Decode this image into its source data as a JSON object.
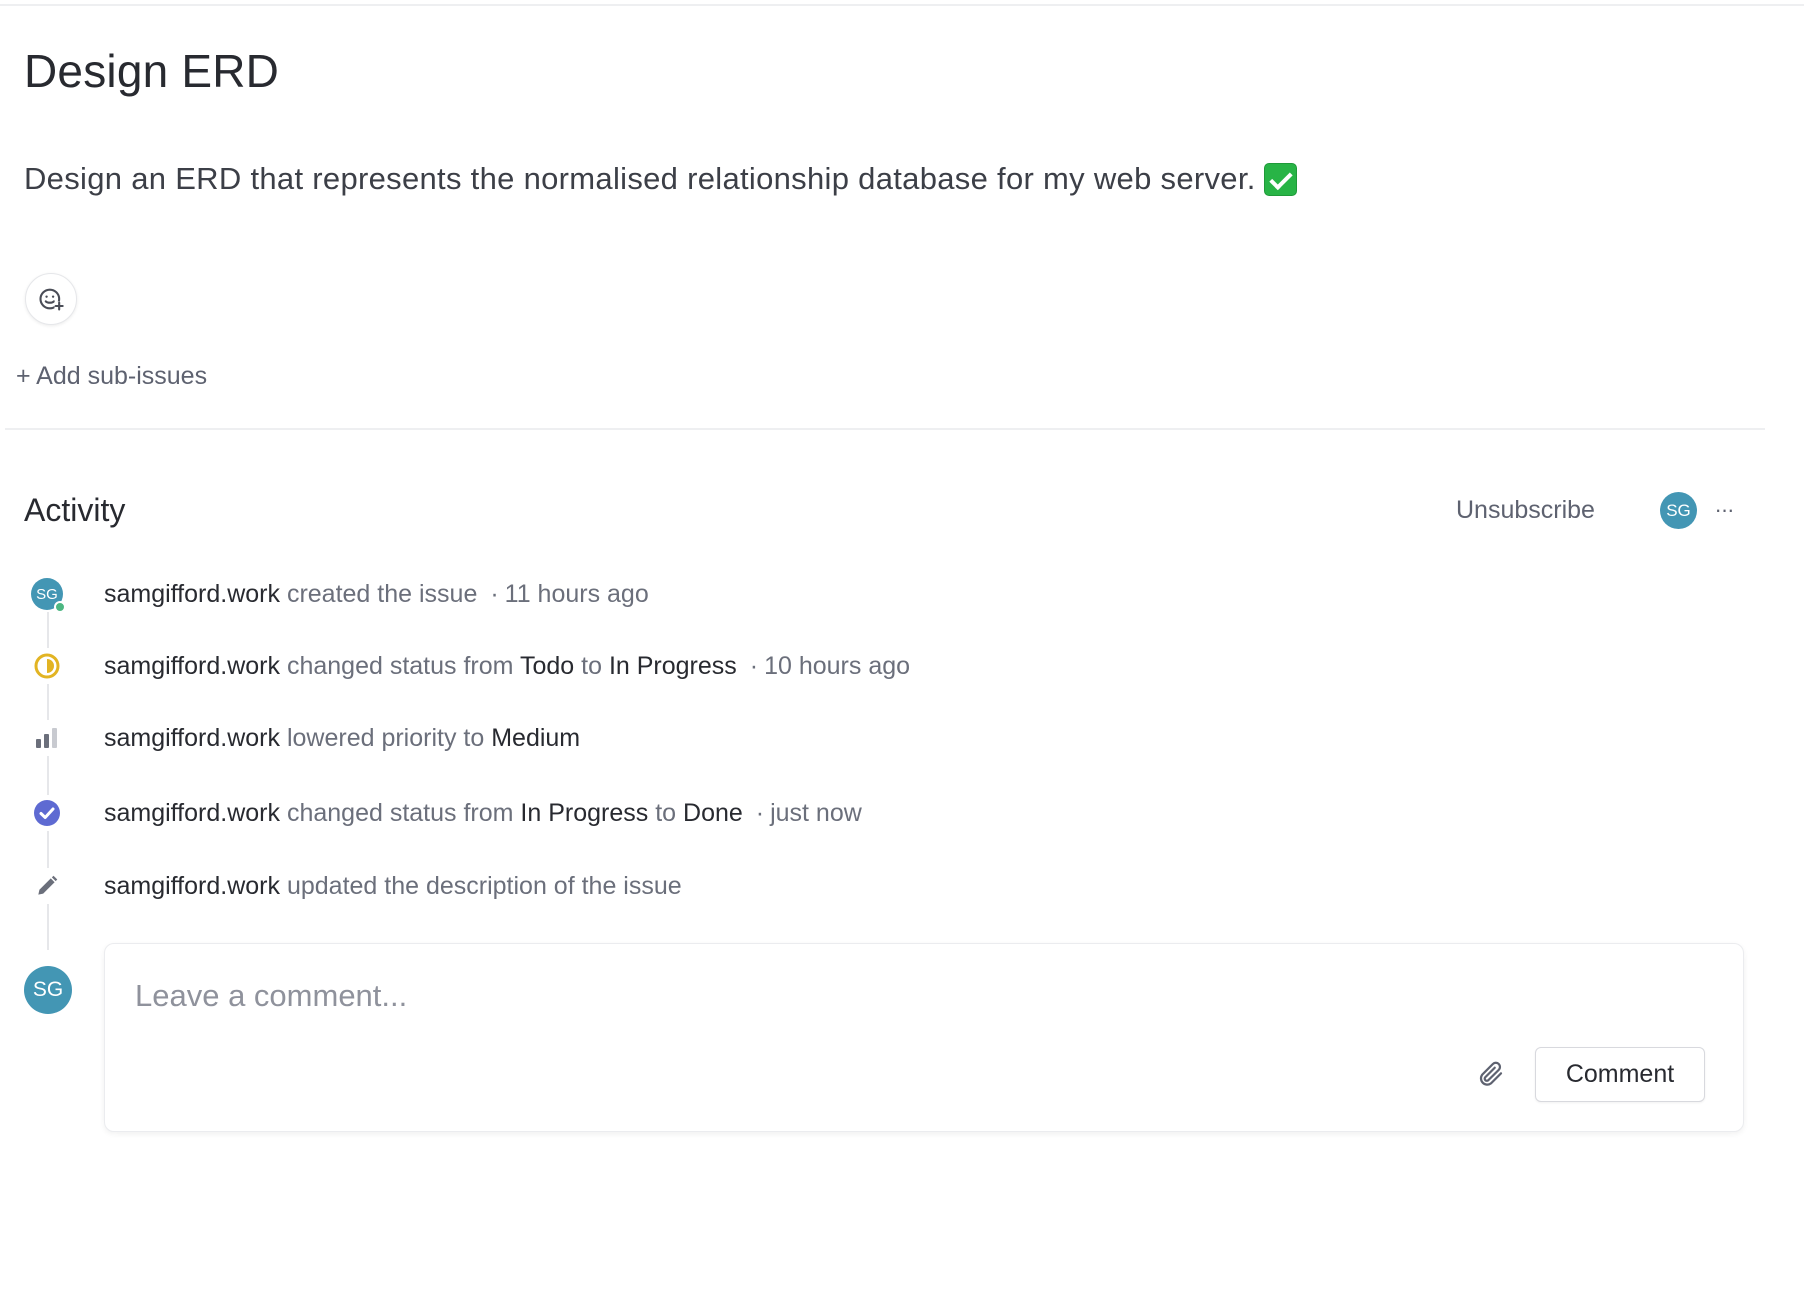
{
  "issue": {
    "title": "Design ERD",
    "description": "Design an ERD that represents the normalised relationship database for my web server.",
    "description_emoji": "white-check-mark-emoji"
  },
  "add_sub_issues_label": "+ Add sub-issues",
  "activity": {
    "heading": "Activity",
    "unsubscribe_label": "Unsubscribe",
    "subscriber_initials": "SG",
    "more_label": "···",
    "items": [
      {
        "icon": "user-avatar",
        "initials": "SG",
        "user": "samgifford.work",
        "text_1": "created the issue",
        "time": "11 hours ago"
      },
      {
        "icon": "in-progress-status-icon",
        "user": "samgifford.work",
        "text_1": "changed status from",
        "from": "Todo",
        "text_2": "to",
        "to": "In Progress",
        "time": "10 hours ago"
      },
      {
        "icon": "priority-medium-icon",
        "user": "samgifford.work",
        "text_1": "lowered priority to",
        "to": "Medium"
      },
      {
        "icon": "done-status-icon",
        "user": "samgifford.work",
        "text_1": "changed status from",
        "from": "In Progress",
        "text_2": "to",
        "to": "Done",
        "time": "just now"
      },
      {
        "icon": "pencil-icon",
        "user": "samgifford.work",
        "text_1": "updated the description of the issue"
      }
    ]
  },
  "comment": {
    "avatar_initials": "SG",
    "placeholder": "Leave a comment...",
    "submit_label": "Comment"
  },
  "colors": {
    "avatar": "#4396b4",
    "in_progress": "#e2b423",
    "done": "#5e6ad2",
    "online": "#4cb782"
  }
}
